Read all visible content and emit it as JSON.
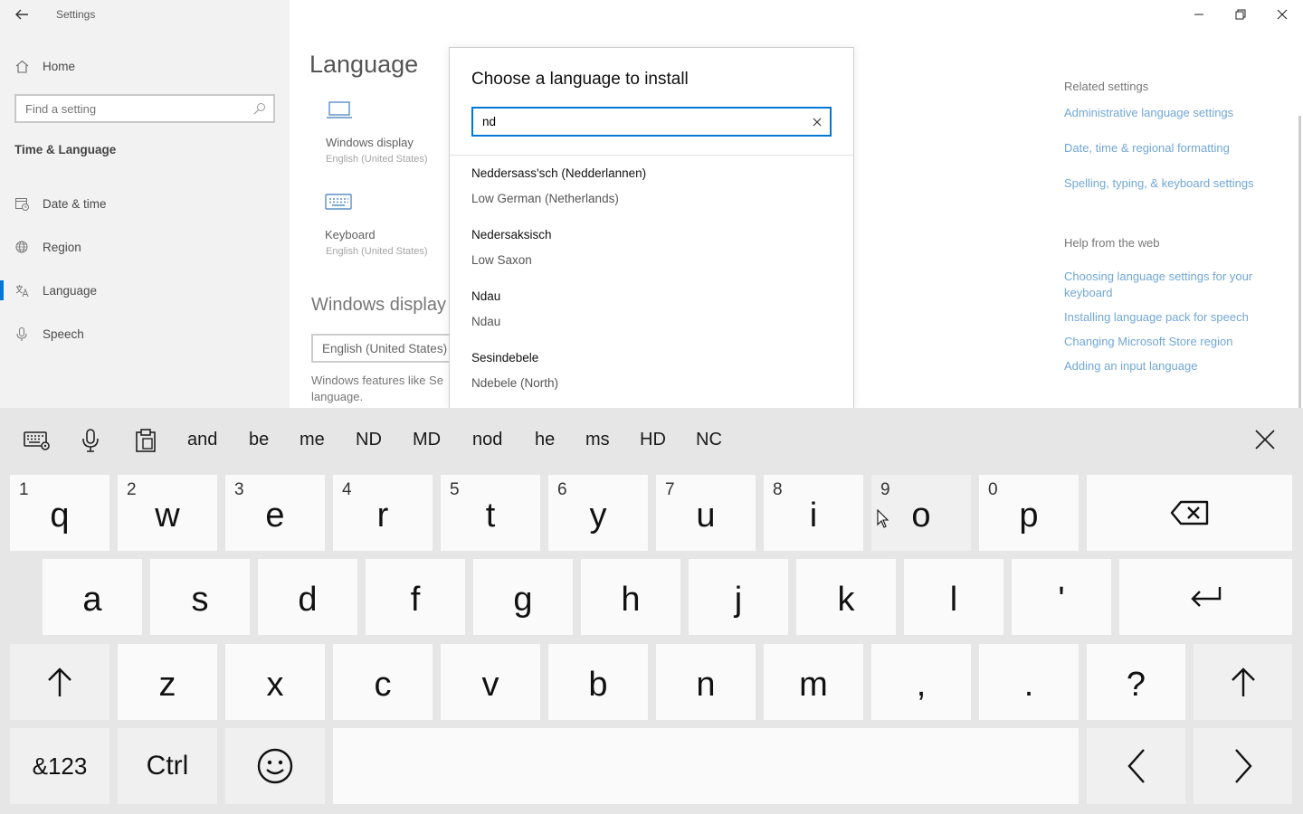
{
  "window": {
    "title": "Settings"
  },
  "sidebar": {
    "home_label": "Home",
    "search_placeholder": "Find a setting",
    "section_title": "Time & Language",
    "items": [
      {
        "label": "Date & time",
        "icon": "calendar-clock-icon"
      },
      {
        "label": "Region",
        "icon": "globe-icon"
      },
      {
        "label": "Language",
        "icon": "language-icon",
        "active": true
      },
      {
        "label": "Speech",
        "icon": "microphone-icon"
      }
    ]
  },
  "main": {
    "page_title": "Language",
    "tiles": [
      {
        "title": "Windows display",
        "subtitle": "English (United States)",
        "icon": "monitor-icon"
      },
      {
        "title": "Keyboard",
        "subtitle": "English (United States)",
        "icon": "keyboard-icon"
      }
    ],
    "windows_display_heading": "Windows display",
    "display_dropdown_value": "English (United States)",
    "windows_desc": "Windows features like Se language."
  },
  "related": {
    "heading": "Related settings",
    "links": [
      "Administrative language settings",
      "Date, time & regional formatting",
      "Spelling, typing, & keyboard settings"
    ],
    "help_heading": "Help from the web",
    "help_links": [
      "Choosing language settings for your keyboard",
      "Installing language pack for speech",
      "Changing Microsoft Store region",
      "Adding an input language"
    ]
  },
  "dialog": {
    "title": "Choose a language to install",
    "search_value": "nd",
    "results": [
      {
        "native": "Neddersass'sch (Nedderlannen)",
        "english": "Low German (Netherlands)"
      },
      {
        "native": "Nedersaksisch",
        "english": "Low Saxon"
      },
      {
        "native": "Ndau",
        "english": "Ndau"
      },
      {
        "native": "Sesindebele",
        "english": "Ndebele (North)"
      }
    ]
  },
  "keyboard": {
    "suggestions": [
      "and",
      "be",
      "me",
      "ND",
      "MD",
      "nod",
      "he",
      "ms",
      "HD",
      "NC"
    ],
    "row1": [
      {
        "num": "1",
        "ch": "q"
      },
      {
        "num": "2",
        "ch": "w"
      },
      {
        "num": "3",
        "ch": "e"
      },
      {
        "num": "4",
        "ch": "r"
      },
      {
        "num": "5",
        "ch": "t"
      },
      {
        "num": "6",
        "ch": "y"
      },
      {
        "num": "7",
        "ch": "u"
      },
      {
        "num": "8",
        "ch": "i"
      },
      {
        "num": "9",
        "ch": "o"
      },
      {
        "num": "0",
        "ch": "p"
      }
    ],
    "row2": [
      "a",
      "s",
      "d",
      "f",
      "g",
      "h",
      "j",
      "k",
      "l",
      "'"
    ],
    "row3": [
      "z",
      "x",
      "c",
      "v",
      "b",
      "n",
      "m",
      ",",
      ".",
      "?"
    ],
    "symbols_label": "&123",
    "ctrl_label": "Ctrl"
  }
}
